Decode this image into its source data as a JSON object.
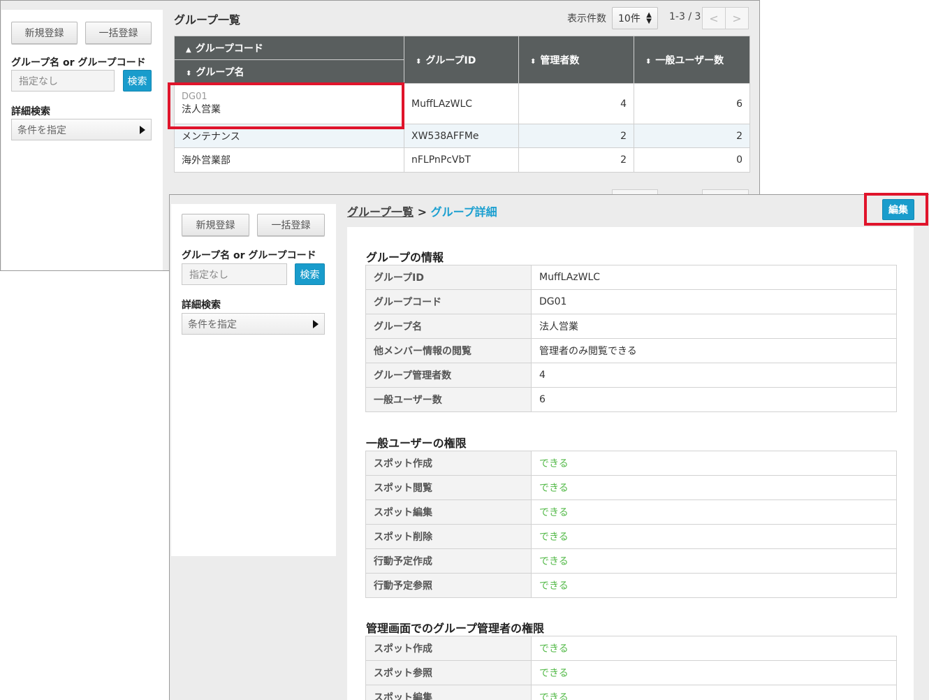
{
  "back": {
    "sidebar": {
      "new_button": "新規登録",
      "bulk_button": "一括登録",
      "search_label": "グループ名 or グループコード",
      "search_placeholder": "指定なし",
      "search_button": "検索",
      "advanced_label": "詳細検索",
      "advanced_value": "条件を指定"
    },
    "list": {
      "title": "グループ一覧",
      "per_page_label": "表示件数",
      "per_page_value": "10件",
      "range": "1-3 / 3",
      "prev_icon": "<",
      "next_icon": ">",
      "sort_up_icon": "▲",
      "sort_both_icon": "⬍",
      "headers": {
        "group_code": "グループコード",
        "group_name": "グループ名",
        "group_id": "グループID",
        "admin_count": "管理者数",
        "user_count": "一般ユーザー数"
      },
      "rows": [
        {
          "code": "DG01",
          "name": "法人営業",
          "id": "MuffLAzWLC",
          "admins": "4",
          "users": "6"
        },
        {
          "code": "",
          "name": "メンテナンス",
          "id": "XW538AFFMe",
          "admins": "2",
          "users": "2"
        },
        {
          "code": "",
          "name": "海外営業部",
          "id": "nFLPnPcVbT",
          "admins": "2",
          "users": "0"
        }
      ]
    }
  },
  "front": {
    "sidebar": {
      "new_button": "新規登録",
      "bulk_button": "一括登録",
      "search_label": "グループ名 or グループコード",
      "search_placeholder": "指定なし",
      "search_button": "検索",
      "advanced_label": "詳細検索",
      "advanced_value": "条件を指定"
    },
    "breadcrumb": {
      "parent": "グループ一覧",
      "separator": ">",
      "current": "グループ詳細"
    },
    "edit_button": "編集",
    "info": {
      "title": "グループの情報",
      "rows": [
        {
          "key": "グループID",
          "value": "MuffLAzWLC"
        },
        {
          "key": "グループコード",
          "value": "DG01"
        },
        {
          "key": "グループ名",
          "value": "法人営業"
        },
        {
          "key": "他メンバー情報の閲覧",
          "value": "管理者のみ閲覧できる"
        },
        {
          "key": "グループ管理者数",
          "value": "4"
        },
        {
          "key": "一般ユーザー数",
          "value": "6"
        }
      ]
    },
    "user_perms": {
      "title": "一般ユーザーの権限",
      "rows": [
        {
          "key": "スポット作成",
          "value": "できる"
        },
        {
          "key": "スポット閲覧",
          "value": "できる"
        },
        {
          "key": "スポット編集",
          "value": "できる"
        },
        {
          "key": "スポット削除",
          "value": "できる"
        },
        {
          "key": "行動予定作成",
          "value": "できる"
        },
        {
          "key": "行動予定参照",
          "value": "できる"
        }
      ]
    },
    "admin_perms": {
      "title": "管理画面でのグループ管理者の権限",
      "rows": [
        {
          "key": "スポット作成",
          "value": "できる"
        },
        {
          "key": "スポット参照",
          "value": "できる"
        },
        {
          "key": "スポット編集",
          "value": "できる"
        }
      ]
    }
  },
  "colors": {
    "highlight_red": "#e0142b",
    "accent_blue": "#199ccc",
    "ok_green": "#52b947",
    "table_header": "#595e5e"
  }
}
